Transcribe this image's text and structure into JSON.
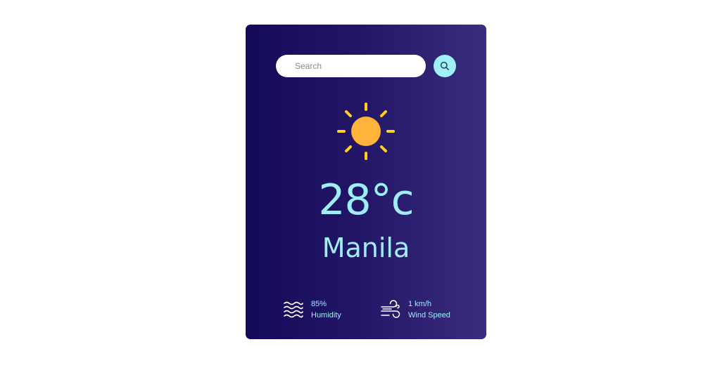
{
  "search": {
    "placeholder": "Search",
    "value": "",
    "button_icon": "search-icon"
  },
  "weather": {
    "icon": "sun-icon",
    "temperature": "28°c",
    "city": "Manila"
  },
  "details": {
    "humidity": {
      "icon": "humidity-waves-icon",
      "value": "85%",
      "label": "Humidity"
    },
    "wind": {
      "icon": "wind-icon",
      "value": "1 km/h",
      "label": "Wind Speed"
    }
  },
  "colors": {
    "card_gradient_start": "#140a5a",
    "card_gradient_end": "#3a2d7d",
    "accent": "#9eeefa",
    "sun": "#ffb33a",
    "sun_rays": "#ffd21a"
  }
}
